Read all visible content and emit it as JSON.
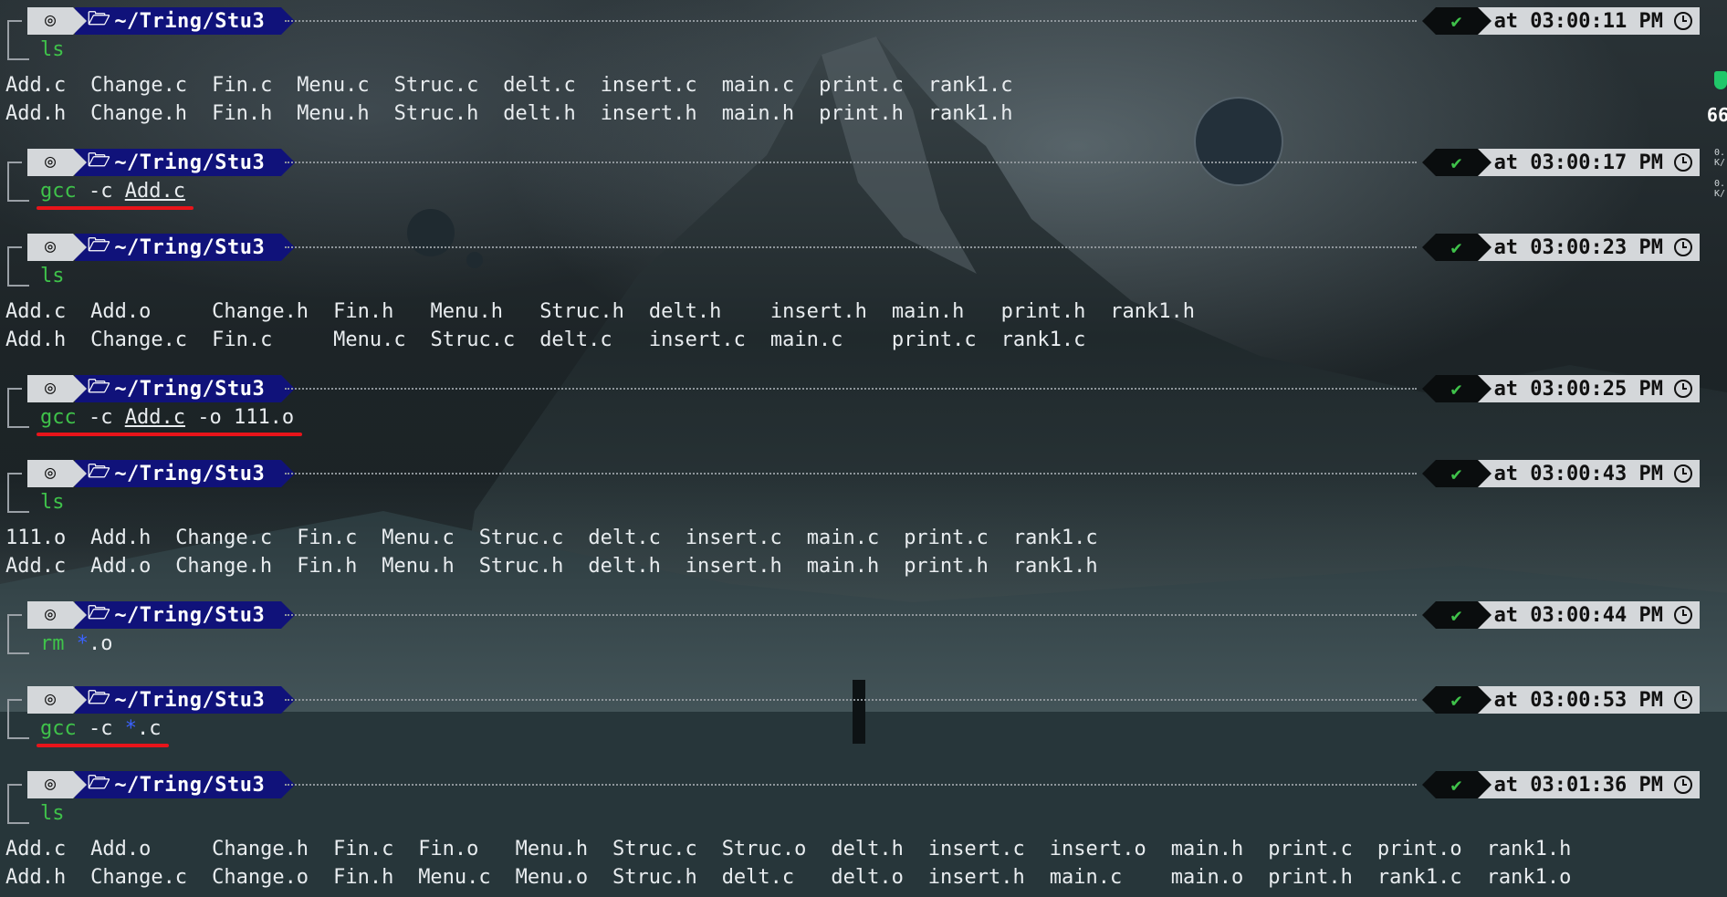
{
  "prompt": {
    "os_icon": "terminal-logo-icon",
    "folder_icon": "folder-open-icon",
    "path": "~/Tring/Stu3",
    "status_icon": "check-icon",
    "status": "✔"
  },
  "blocks": [
    {
      "time": "at 03:00:11 PM",
      "cmd": [
        {
          "t": "ls",
          "c": "green"
        }
      ],
      "output": [
        [
          "Add.c",
          "Change.c",
          "Fin.c",
          "Menu.c",
          "Struc.c",
          "delt.c",
          "insert.c",
          "main.c",
          "print.c",
          "rank1.c"
        ],
        [
          "Add.h",
          "Change.h",
          "Fin.h",
          "Menu.h",
          "Struc.h",
          "delt.h",
          "insert.h",
          "main.h",
          "print.h",
          "rank1.h"
        ]
      ]
    },
    {
      "time": "at 03:00:17 PM",
      "cmd": [
        {
          "t": "gcc",
          "c": "green"
        },
        {
          "t": " -c "
        },
        {
          "t": "Add.c",
          "c": "ul"
        }
      ],
      "output": []
    },
    {
      "time": "at 03:00:23 PM",
      "cmd": [
        {
          "t": "ls",
          "c": "green"
        }
      ],
      "output": [
        [
          "Add.c",
          "Add.o",
          "Change.h",
          "Fin.h",
          "Menu.h",
          "Struc.h",
          "delt.h",
          "insert.h",
          "main.h",
          "print.h",
          "rank1.h"
        ],
        [
          "Add.h",
          "Change.c",
          "Fin.c",
          "Menu.c",
          "Struc.c",
          "delt.c",
          "insert.c",
          "main.c",
          "print.c",
          "rank1.c"
        ]
      ]
    },
    {
      "time": "at 03:00:25 PM",
      "cmd": [
        {
          "t": "gcc",
          "c": "green"
        },
        {
          "t": " -c "
        },
        {
          "t": "Add.c",
          "c": "ul"
        },
        {
          "t": " -o 111.o"
        }
      ],
      "output": []
    },
    {
      "time": "at 03:00:43 PM",
      "cmd": [
        {
          "t": "ls",
          "c": "green"
        }
      ],
      "output": [
        [
          "111.o",
          "Add.h",
          "Change.c",
          "Fin.c",
          "Menu.c",
          "Struc.c",
          "delt.c",
          "insert.c",
          "main.c",
          "print.c",
          "rank1.c"
        ],
        [
          "Add.c",
          "Add.o",
          "Change.h",
          "Fin.h",
          "Menu.h",
          "Struc.h",
          "delt.h",
          "insert.h",
          "main.h",
          "print.h",
          "rank1.h"
        ]
      ]
    },
    {
      "time": "at 03:00:44 PM",
      "cmd": [
        {
          "t": "rm",
          "c": "green"
        },
        {
          "t": " "
        },
        {
          "t": "*",
          "c": "blue"
        },
        {
          "t": ".o"
        }
      ],
      "output": []
    },
    {
      "time": "at 03:00:53 PM",
      "cmd": [
        {
          "t": "gcc",
          "c": "green"
        },
        {
          "t": " -c "
        },
        {
          "t": "*",
          "c": "blue"
        },
        {
          "t": ".c"
        }
      ],
      "output": []
    },
    {
      "time": "at 03:01:36 PM",
      "cmd": [
        {
          "t": "ls",
          "c": "green"
        }
      ],
      "output": [
        [
          "Add.c",
          "Add.o",
          "Change.h",
          "Fin.c",
          "Fin.o",
          "Menu.h",
          "Struc.c",
          "Struc.o",
          "delt.h",
          "insert.c",
          "insert.o",
          "main.h",
          "print.c",
          "print.o",
          "rank1.h"
        ],
        [
          "Add.h",
          "Change.c",
          "Change.o",
          "Fin.h",
          "Menu.c",
          "Menu.o",
          "Struc.h",
          "delt.c",
          "delt.o",
          "insert.h",
          "main.c",
          "main.o",
          "print.h",
          "rank1.c",
          "rank1.o"
        ]
      ]
    }
  ],
  "side_widget": {
    "icon": "shield-icon",
    "percent": "66",
    "net_up": "0.",
    "net_up_unit": "K/",
    "net_down": "0.",
    "net_down_unit": "K/"
  },
  "colors": {
    "dir_bg": "#10127a",
    "ok": "#3fc24a",
    "underline_marker": "#e8141a",
    "glob": "#3b62ff"
  }
}
